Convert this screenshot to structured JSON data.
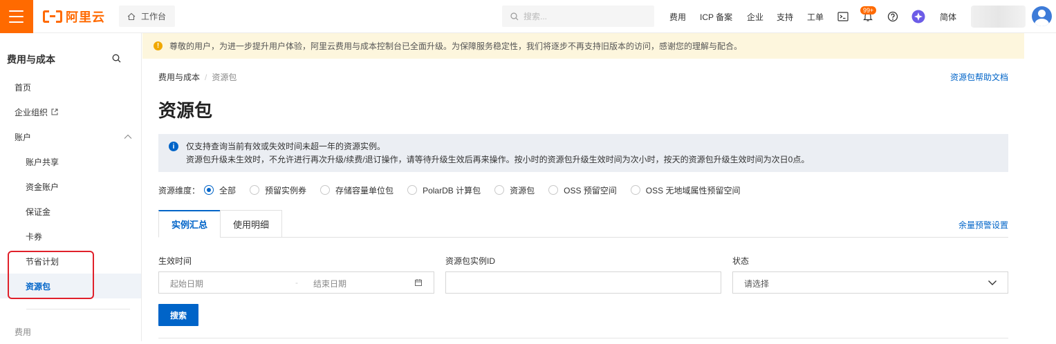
{
  "topbar": {
    "logo_text": "阿里云",
    "workbench_label": "工作台",
    "search_placeholder": "搜索...",
    "nav": [
      "费用",
      "ICP 备案",
      "企业",
      "支持",
      "工单"
    ],
    "notification_badge": "99+",
    "language": "简体",
    "brand_color": "#ff6a00"
  },
  "sidebar": {
    "title": "费用与成本",
    "items": [
      {
        "label": "首页"
      },
      {
        "label": "企业组织"
      },
      {
        "label": "账户"
      },
      {
        "label": "账户共享"
      },
      {
        "label": "资金账户"
      },
      {
        "label": "保证金"
      },
      {
        "label": "卡券"
      },
      {
        "label": "节省计划"
      },
      {
        "label": "资源包"
      },
      {
        "label": "费用"
      }
    ]
  },
  "notice": {
    "text": "尊敬的用户，为进一步提升用户体验，阿里云费用与成本控制台已全面升级。为保障服务稳定性，我们将逐步不再支持旧版本的访问，感谢您的理解与配合。"
  },
  "breadcrumb": {
    "root": "费用与成本",
    "current": "资源包"
  },
  "help_link": "资源包帮助文档",
  "page_title": "资源包",
  "info": {
    "line1": "仅支持查询当前有效或失效时间未超一年的资源实例。",
    "line2": "资源包升级未生效时，不允许进行再次升级/续费/退订操作，请等待升级生效后再来操作。按小时的资源包升级生效时间为次小时，按天的资源包升级生效时间为次日0点。"
  },
  "dimension": {
    "label": "资源维度：",
    "options": [
      "全部",
      "预留实例券",
      "存储容量单位包",
      "PolarDB 计算包",
      "资源包",
      "OSS 预留空间",
      "OSS 无地域属性预留空间"
    ],
    "selected": "全部"
  },
  "tabs": {
    "items": [
      "实例汇总",
      "使用明细"
    ],
    "active": "实例汇总",
    "warning_link": "余量预警设置"
  },
  "filters": {
    "effective_time_label": "生效时间",
    "start_placeholder": "起始日期",
    "end_placeholder": "结束日期",
    "instance_id_label": "资源包实例ID",
    "instance_id_value": "",
    "status_label": "状态",
    "status_placeholder": "请选择",
    "search_button": "搜索"
  },
  "accent_color": "#0064c8"
}
